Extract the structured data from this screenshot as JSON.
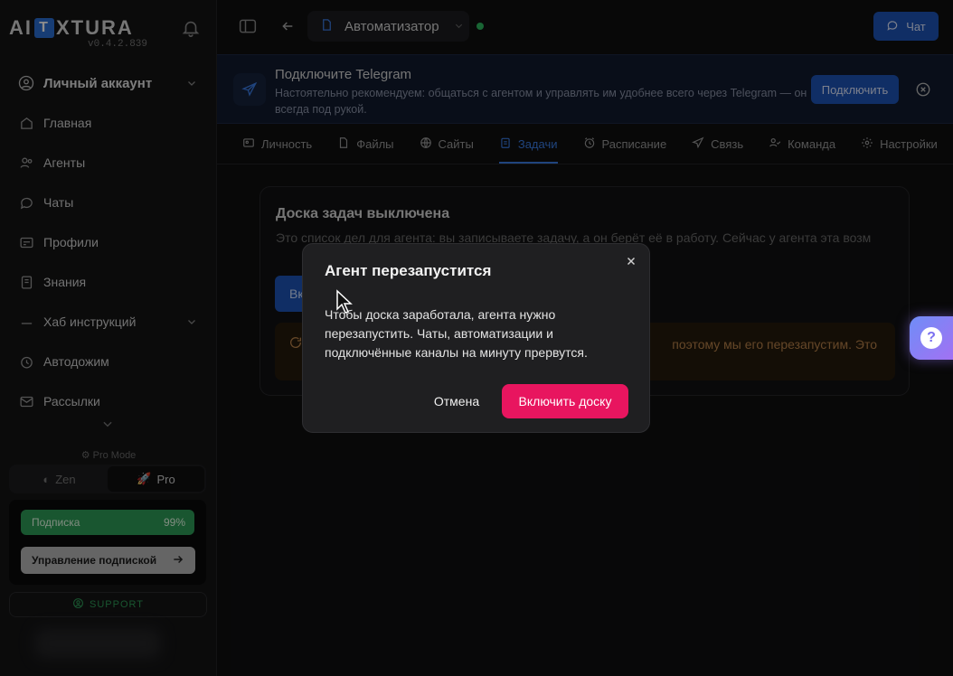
{
  "app": {
    "logo_left": "AI",
    "logo_box": "T",
    "logo_right": "XTURA",
    "version": "v0.4.2.839"
  },
  "sidebar": {
    "account_label": "Личный аккаунт",
    "items": [
      {
        "label": "Главная",
        "icon": "home-icon"
      },
      {
        "label": "Агенты",
        "icon": "agents-icon"
      },
      {
        "label": "Чаты",
        "icon": "chat-icon"
      },
      {
        "label": "Профили",
        "icon": "profile-card-icon"
      },
      {
        "label": "Знания",
        "icon": "book-icon"
      },
      {
        "label": "Хаб инструкций",
        "icon": "hub-icon"
      },
      {
        "label": "Автодожим",
        "icon": "clock-icon"
      },
      {
        "label": "Рассылки",
        "icon": "mail-icon"
      }
    ],
    "pro_mode_label": "Pro Mode",
    "modes": [
      {
        "label": "Zen"
      },
      {
        "label": "Pro"
      }
    ],
    "subscription": {
      "label": "Подписка",
      "percent_label": "99%",
      "progress": 0.99,
      "manage_label": "Управление подпиской"
    },
    "support_label": "SUPPORT"
  },
  "topbar": {
    "agent_name": "Автоматизатор",
    "agent_status_color": "#2fb860",
    "chat_label": "Чат"
  },
  "telegram_banner": {
    "title": "Подключите Telegram",
    "text": "Настоятельно рекомендуем: общаться с агентом и управлять им удобнее всего через Telegram — он всегда под рукой.",
    "connect_label": "Подключить"
  },
  "tabs": [
    {
      "label": "Личность",
      "icon": "id-card-icon",
      "active": false
    },
    {
      "label": "Файлы",
      "icon": "file-icon",
      "active": false
    },
    {
      "label": "Сайты",
      "icon": "globe-icon",
      "active": false
    },
    {
      "label": "Задачи",
      "icon": "clipboard-icon",
      "active": true
    },
    {
      "label": "Расписание",
      "icon": "alarm-icon",
      "active": false
    },
    {
      "label": "Связь",
      "icon": "send-icon",
      "active": false
    },
    {
      "label": "Команда",
      "icon": "team-icon",
      "active": false
    },
    {
      "label": "Настройки",
      "icon": "gear-icon",
      "active": false
    }
  ],
  "card": {
    "title": "Доска задач выключена",
    "text": "Это список дел для агента: вы записываете задачу, а он берёт её в работу. Сейчас у агента эта возм",
    "button_label": "Вк",
    "warning_text": "поэтому мы его перезапустим. Это"
  },
  "modal": {
    "title": "Агент перезапустится",
    "body": "Чтобы доска заработала, агента нужно перезапустить. Чаты, автоматизации и подключённые каналы на минуту прервутся.",
    "cancel_label": "Отмена",
    "confirm_label": "Включить доску"
  },
  "help": {
    "glyph": "?"
  },
  "colors": {
    "accent": "#1e55b8",
    "active_tab": "#3b7de6",
    "danger": "#e8155f",
    "success": "#2e9d58"
  }
}
